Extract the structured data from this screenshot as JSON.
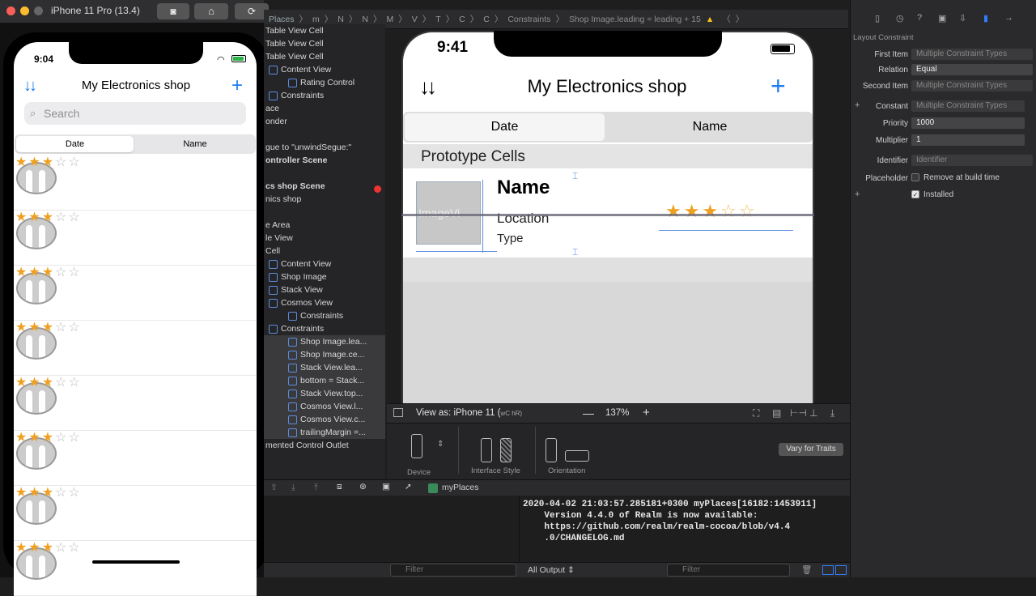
{
  "simulator": {
    "title": "iPhone 11 Pro (13.4)",
    "status_time": "9:04",
    "nav_title": "My Electronics shop",
    "search_placeholder": "Search",
    "segments": [
      "Date",
      "Name"
    ],
    "row_stars_filled": 3,
    "row_stars_total": 5,
    "row_count": 8
  },
  "breadcrumb": {
    "items": [
      "Places",
      "m",
      "N",
      "N",
      "M",
      "V",
      "T",
      "C",
      "C",
      "Constraints",
      "Shop Image.leading = leading + 15"
    ]
  },
  "navigator": {
    "rows": [
      {
        "label": "Table View Cell",
        "indent": 0
      },
      {
        "label": "Table View Cell",
        "indent": 0
      },
      {
        "label": "Table View Cell",
        "indent": 0
      },
      {
        "label": "Content View",
        "indent": 1
      },
      {
        "label": "Rating Control",
        "indent": 2
      },
      {
        "label": "Constraints",
        "indent": 1
      },
      {
        "label": "ace",
        "indent": 0
      },
      {
        "label": "onder",
        "indent": 0
      },
      {
        "label": "",
        "indent": 0
      },
      {
        "label": "gue to \"unwindSegue:\"",
        "indent": 0
      },
      {
        "label": "ontroller Scene",
        "indent": 0,
        "bold": true
      },
      {
        "label": "",
        "indent": 0
      },
      {
        "label": "cs shop Scene",
        "indent": 0,
        "bold": true,
        "error": true
      },
      {
        "label": "nics shop",
        "indent": 0
      },
      {
        "label": "",
        "indent": 0
      },
      {
        "label": "e Area",
        "indent": 0
      },
      {
        "label": "le View",
        "indent": 0
      },
      {
        "label": "Cell",
        "indent": 0
      },
      {
        "label": "Content View",
        "indent": 1
      },
      {
        "label": "Shop Image",
        "indent": 1
      },
      {
        "label": "Stack View",
        "indent": 1
      },
      {
        "label": "Cosmos View",
        "indent": 1
      },
      {
        "label": "Constraints",
        "indent": 2
      },
      {
        "label": "Constraints",
        "indent": 1
      },
      {
        "label": "Shop Image.lea...",
        "indent": 2,
        "sel": true
      },
      {
        "label": "Shop Image.ce...",
        "indent": 2,
        "sel": true
      },
      {
        "label": "Stack View.lea...",
        "indent": 2,
        "sel": true
      },
      {
        "label": "bottom = Stack...",
        "indent": 2,
        "sel": true
      },
      {
        "label": "Stack View.top...",
        "indent": 2,
        "sel": true
      },
      {
        "label": "Cosmos View.l...",
        "indent": 2,
        "sel": true
      },
      {
        "label": "Cosmos View.c...",
        "indent": 2,
        "sel": true
      },
      {
        "label": "trailingMargin =...",
        "indent": 2,
        "sel": true
      },
      {
        "label": "mented Control Outlet",
        "indent": 0
      }
    ]
  },
  "canvas": {
    "time": "9:41",
    "nav_title": "My Electronics shop",
    "segments": [
      "Date",
      "Name"
    ],
    "section": "Prototype Cells",
    "image_label": "ImageVi",
    "cell_name": "Name",
    "cell_location": "Location",
    "cell_type": "Type",
    "view_as": "View as: iPhone 11 (",
    "view_as_traits": "wC hR)",
    "zoom": "137%",
    "device_label": "Device",
    "interface_label": "Interface Style",
    "orientation_label": "Orientation",
    "vary": "Vary for Traits"
  },
  "inspector": {
    "section": "Layout Constraint",
    "first_item_label": "First Item",
    "first_item": "Multiple Constraint Types",
    "relation_label": "Relation",
    "relation": "Equal",
    "second_item_label": "Second Item",
    "second_item": "Multiple Constraint Types",
    "constant_label": "Constant",
    "constant": "Multiple Constraint Types",
    "priority_label": "Priority",
    "priority": "1000",
    "multiplier_label": "Multiplier",
    "multiplier": "1",
    "identifier_label": "Identifier",
    "identifier_placeholder": "Identifier",
    "placeholder_label": "Placeholder",
    "remove_label": "Remove at build time",
    "installed_label": "Installed"
  },
  "debug": {
    "scheme": "myPlaces",
    "console_text": "2020-04-02 21:03:57.285181+0300 myPlaces[16182:1453911]\n    Version 4.4.0 of Realm is now available:\n    https://github.com/realm/realm-cocoa/blob/v4.4\n    .0/CHANGELOG.md",
    "filter": "Filter",
    "output": "All Output"
  },
  "colors": {
    "accent": "#1f7bf0",
    "star": "#f0a020"
  }
}
